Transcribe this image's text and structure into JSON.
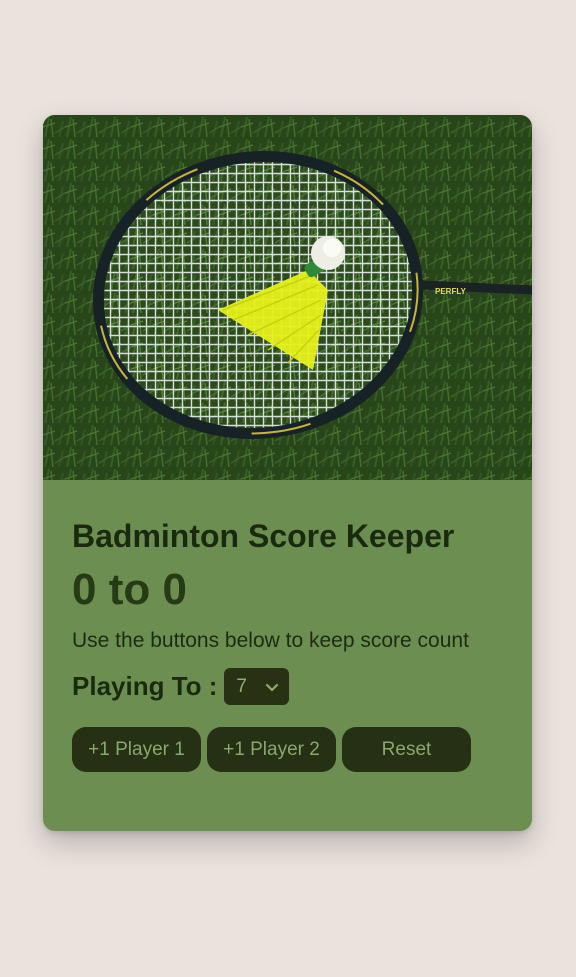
{
  "app": {
    "title": "Badminton Score Keeper",
    "score_display": "0 to 0",
    "instructions": "Use the buttons below to keep score count"
  },
  "playing_to": {
    "label": "Playing To :",
    "selected": "7"
  },
  "buttons": {
    "player1": "+1 Player 1",
    "player2": "+1 Player 2",
    "reset": "Reset"
  },
  "hero": {
    "racket_brand": "PERFLY"
  },
  "colors": {
    "page_bg": "#ebe2de",
    "card_bg": "#6c8f51",
    "button_bg": "#263014",
    "button_text": "#88a86c",
    "title_text": "#1a2a0e"
  }
}
